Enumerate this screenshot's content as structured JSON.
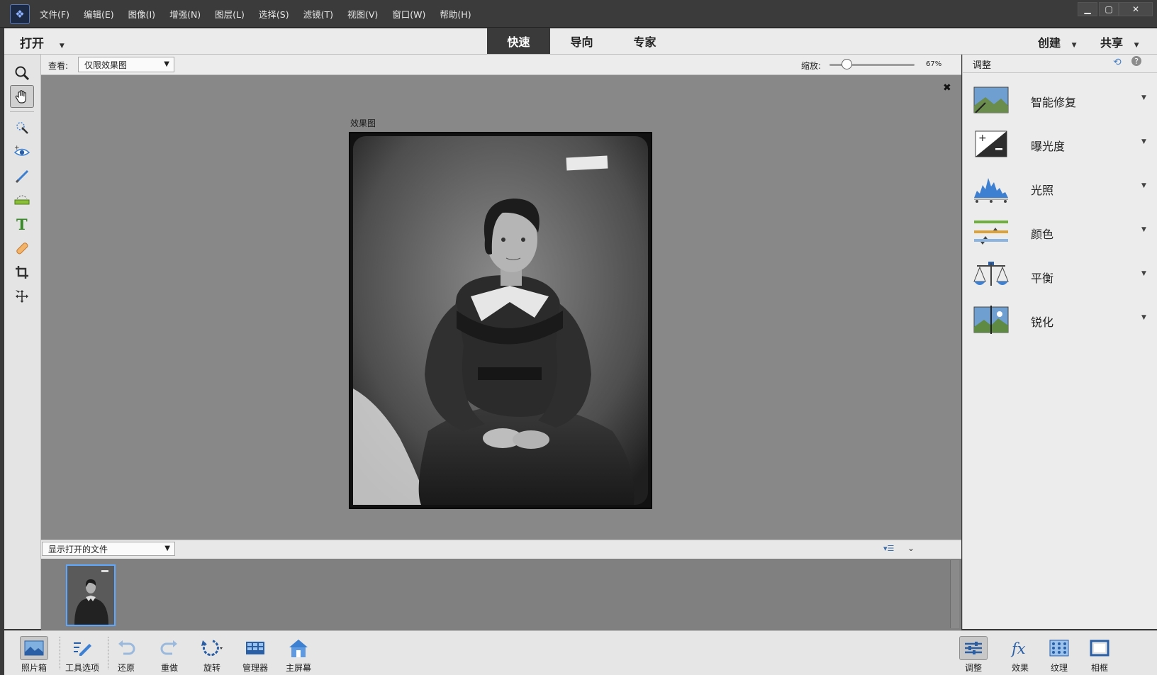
{
  "menu": [
    "文件(F)",
    "编辑(E)",
    "图像(I)",
    "增强(N)",
    "图层(L)",
    "选择(S)",
    "滤镜(T)",
    "视图(V)",
    "窗口(W)",
    "帮助(H)"
  ],
  "modebar": {
    "open_label": "打开",
    "tabs": [
      {
        "label": "快速",
        "active": true
      },
      {
        "label": "导向",
        "active": false
      },
      {
        "label": "专家",
        "active": false
      }
    ],
    "create_label": "创建",
    "share_label": "共享"
  },
  "options": {
    "view_label": "查看:",
    "view_value": "仅限效果图",
    "zoom_label": "缩放:",
    "zoom_value": "67%",
    "zoom_fraction": 0.2
  },
  "canvas": {
    "effect_label": "效果图"
  },
  "bin": {
    "show_label": "显示打开的文件"
  },
  "panel": {
    "title": "调整",
    "items": [
      {
        "label": "智能修复",
        "icon": "smart-fix-icon"
      },
      {
        "label": "曝光度",
        "icon": "exposure-icon"
      },
      {
        "label": "光照",
        "icon": "lighting-icon"
      },
      {
        "label": "颜色",
        "icon": "color-icon"
      },
      {
        "label": "平衡",
        "icon": "balance-icon"
      },
      {
        "label": "锐化",
        "icon": "sharpen-icon"
      }
    ]
  },
  "bottom": {
    "left": [
      {
        "label": "照片箱",
        "icon": "photo-bin-icon"
      },
      {
        "label": "工具选项",
        "icon": "tool-options-icon"
      },
      {
        "label": "还原",
        "icon": "undo-icon"
      },
      {
        "label": "重做",
        "icon": "redo-icon"
      },
      {
        "label": "旋转",
        "icon": "rotate-icon"
      },
      {
        "label": "管理器",
        "icon": "organizer-icon"
      },
      {
        "label": "主屏幕",
        "icon": "home-icon"
      }
    ],
    "right": [
      {
        "label": "调整",
        "icon": "adjust-icon"
      },
      {
        "label": "效果",
        "icon": "effects-icon"
      },
      {
        "label": "纹理",
        "icon": "texture-icon"
      },
      {
        "label": "相框",
        "icon": "frame-icon"
      }
    ]
  },
  "colors": {
    "accent_blue": "#3d7fd1",
    "active_tab": "#3a3a3a",
    "canvas": "#888888"
  }
}
